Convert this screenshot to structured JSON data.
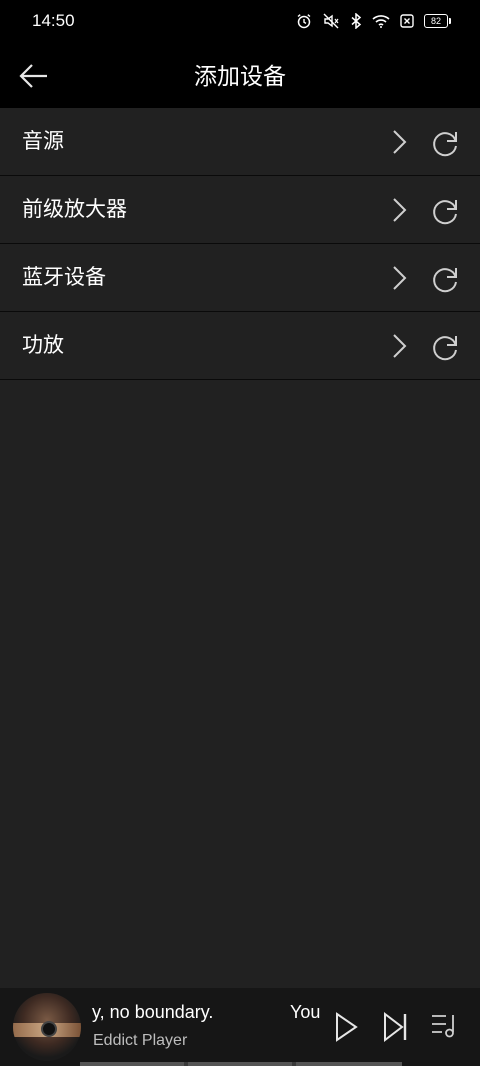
{
  "status_bar": {
    "time": "14:50",
    "battery": "82",
    "icons": [
      "alarm-icon",
      "mute-icon",
      "bluetooth-icon",
      "wifi-icon",
      "no-sim-icon",
      "battery-icon"
    ]
  },
  "header": {
    "title": "添加设备",
    "back_icon": "arrow-left-icon"
  },
  "device_categories": [
    {
      "label": "音源"
    },
    {
      "label": "前级放大器"
    },
    {
      "label": "蓝牙设备"
    },
    {
      "label": "功放"
    }
  ],
  "player": {
    "lyric": "y, no boundary.",
    "lyric_next": "You",
    "artist": "Eddict Player",
    "controls": [
      "play-icon",
      "skip-next-icon",
      "playlist-icon"
    ]
  },
  "colors": {
    "background": "#212121",
    "header_background": "#000000",
    "divider": "#0a0a0a",
    "icon": "#cfcfcf"
  }
}
